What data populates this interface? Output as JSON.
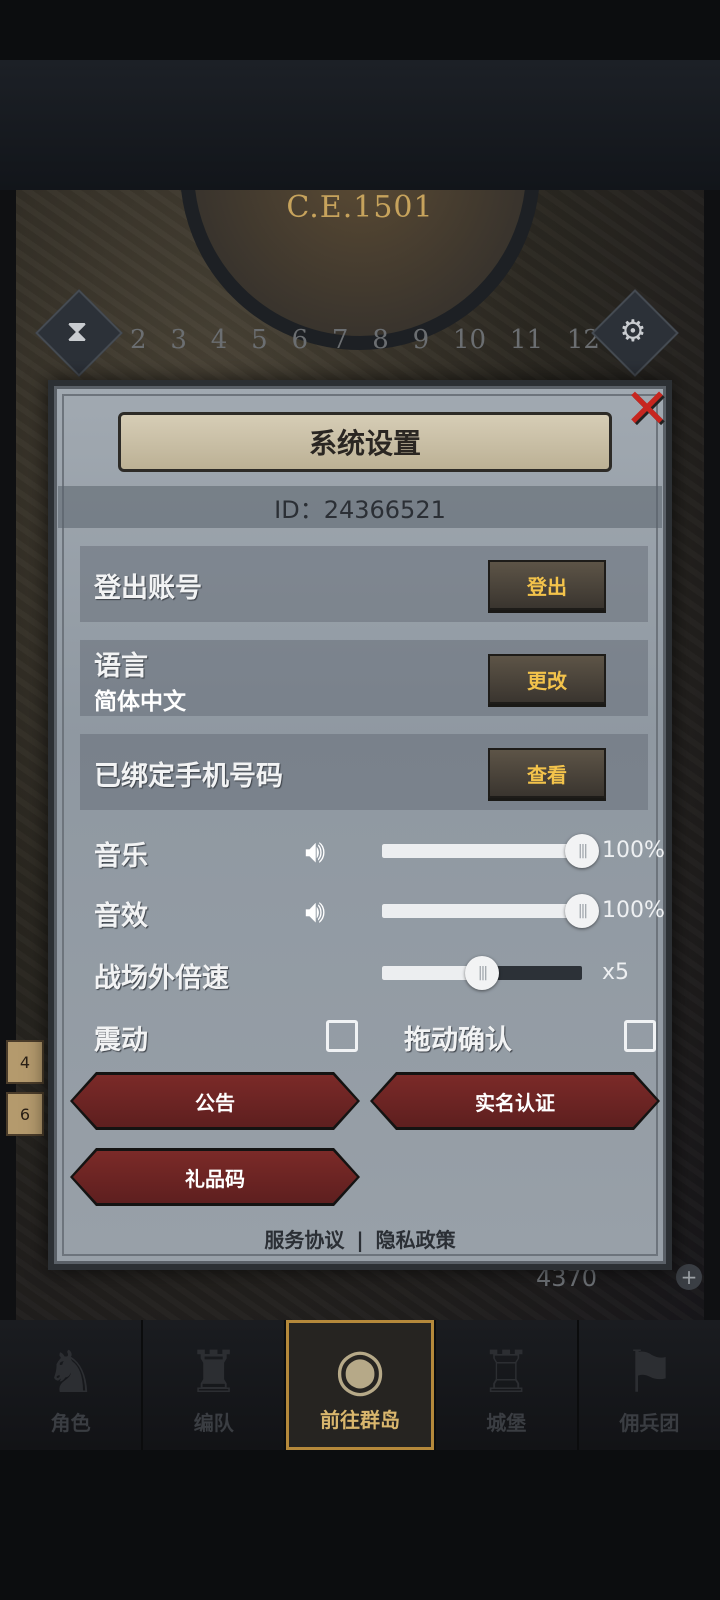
{
  "world": {
    "year": "C.E.1501",
    "dial_numbers": [
      "2",
      "3",
      "4",
      "5",
      "6",
      "7",
      "8",
      "9",
      "10",
      "11",
      "12"
    ],
    "resource_value": "4370"
  },
  "dialog": {
    "title": "系统设置",
    "id_text": "ID：24366521",
    "logout": {
      "label": "登出账号",
      "button": "登出"
    },
    "language": {
      "label": "语言",
      "value": "简体中文",
      "button": "更改"
    },
    "phone": {
      "label": "已绑定手机号码",
      "button": "查看"
    },
    "music": {
      "label": "音乐",
      "level": 1.0,
      "value_text": "100%"
    },
    "sfx": {
      "label": "音效",
      "level": 1.0,
      "value_text": "100%"
    },
    "speed": {
      "label": "战场外倍速",
      "level": 0.5,
      "value_text": "x5"
    },
    "vibration": {
      "label": "震动",
      "checked": false
    },
    "drag_confirm": {
      "label": "拖动确认",
      "checked": false
    },
    "buttons": {
      "notice": "公告",
      "realname": "实名认证",
      "gift": "礼品码"
    },
    "links": {
      "service": "服务协议",
      "divider": "|",
      "privacy": "隐私政策"
    }
  },
  "side_tabs": [
    "4",
    "6"
  ],
  "nav": [
    {
      "label": "角色",
      "icon": "knight-helmet-icon"
    },
    {
      "label": "编队",
      "icon": "armored-knight-icon"
    },
    {
      "label": "前往群岛",
      "icon": "compass-icon",
      "active": true
    },
    {
      "label": "城堡",
      "icon": "castle-icon"
    },
    {
      "label": "佣兵团",
      "icon": "banner-icon"
    }
  ],
  "colors": {
    "accent_gold": "#f3c34b",
    "close_red": "#c7261f",
    "nav_active": "#d9b66d"
  }
}
